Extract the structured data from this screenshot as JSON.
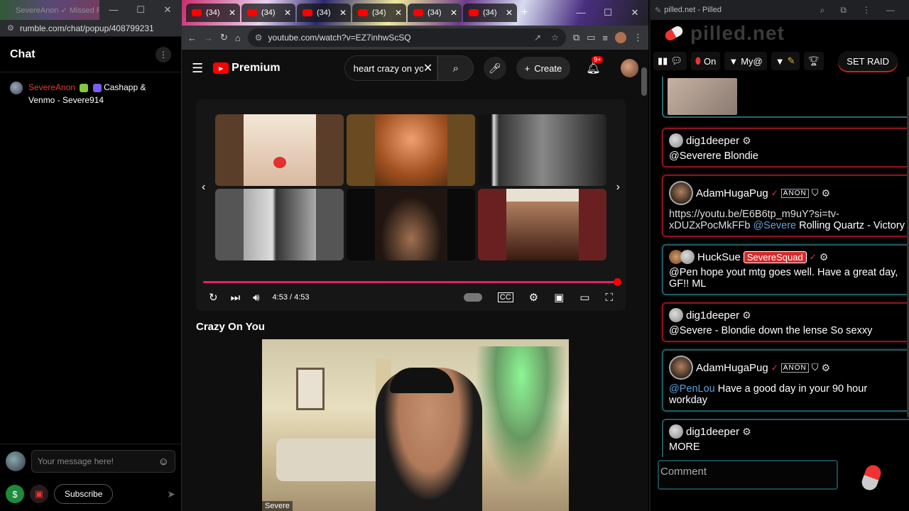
{
  "rumble": {
    "tab_title": "SevereAnon ✓ Missed R...",
    "url": "rumble.com/chat/popup/408799231",
    "chat_title": "Chat",
    "message": {
      "user": "SevereAnon",
      "text": "Cashapp & Venmo - Severe914"
    },
    "input_placeholder": "Your message here!",
    "subscribe_label": "Subscribe"
  },
  "youtube": {
    "tabs": [
      {
        "label": "(34)"
      },
      {
        "label": "(34)"
      },
      {
        "label": "(34)"
      },
      {
        "label": "(34)"
      },
      {
        "label": "(34)"
      },
      {
        "label": "(34)"
      }
    ],
    "url": "youtube.com/watch?v=EZ7inhwScSQ",
    "logo": "Premium",
    "search_value": "heart crazy on yo",
    "create_label": "Create",
    "notif_count": "9+",
    "time": "4:53 / 4:53",
    "video_title": "Crazy On You",
    "cam_label": "Severe",
    "progress": 1.0
  },
  "pilled": {
    "window_title": "pilled.net - Pilled",
    "logo": "pilled.net",
    "toolbar": {
      "on_label": "On",
      "my_label": "My@",
      "raid_label": "SET RAID"
    },
    "messages": [
      {
        "user": "dig1deeper",
        "text": "@Severere Blondie",
        "style": "red"
      },
      {
        "user": "AdamHugaPug",
        "link": "https://youtu.be/E6B6tp_m9uY?si=tv-xDUZxPocMkFFb",
        "mention": "@Severe",
        "text": "Rolling Quartz - Victory",
        "style": "red"
      },
      {
        "user": "HuckSue",
        "tag": "SevereSquad",
        "text": "@Pen hope yout mtg goes well. Have a great day, GF!! ML",
        "style": "teal"
      },
      {
        "user": "dig1deeper",
        "text": "@Severe - Blondie down the lense So sexxy",
        "style": "red"
      },
      {
        "user": "AdamHugaPug",
        "mention": "@PenLou",
        "text": "Have a good day in your 90 hour workday",
        "style": "teal"
      },
      {
        "user": "dig1deeper",
        "text": "MORE",
        "style": "teal"
      }
    ],
    "comment_placeholder": "Comment"
  }
}
